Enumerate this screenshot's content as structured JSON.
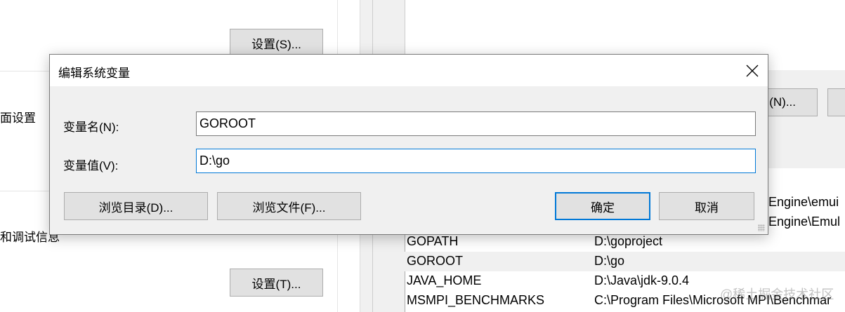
{
  "background": {
    "left_panel": {
      "settings_s": "设置(S)...",
      "label_desktop": "面设置",
      "label_debug": "和调试信息",
      "settings_t": "设置(T)..."
    },
    "right_panel": {
      "new_button": "(N)...",
      "partial_values": [
        "Engine\\emui",
        "Engine\\Emul"
      ],
      "rows": [
        {
          "name": "GOPATH",
          "value": "D:\\goproject"
        },
        {
          "name": "GOROOT",
          "value": "D:\\go"
        },
        {
          "name": "JAVA_HOME",
          "value": "D:\\Java\\jdk-9.0.4"
        },
        {
          "name": "MSMPI_BENCHMARKS",
          "value": "C:\\Program Files\\Microsoft MPI\\Benchmar"
        }
      ]
    },
    "watermark": "@稀土掘金技术社区"
  },
  "dialog": {
    "title": "编辑系统变量",
    "name_label": "变量名(N):",
    "name_value": "GOROOT",
    "value_label": "变量值(V):",
    "value_value": "D:\\go",
    "browse_dir": "浏览目录(D)...",
    "browse_file": "浏览文件(F)...",
    "ok": "确定",
    "cancel": "取消"
  }
}
